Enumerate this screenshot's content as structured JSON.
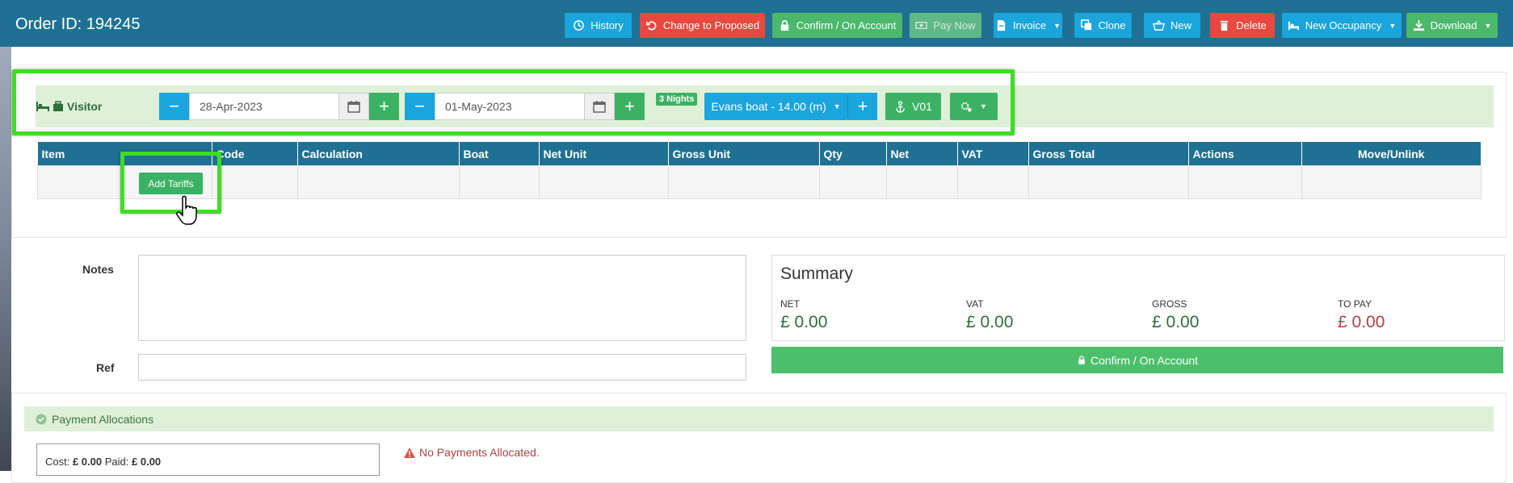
{
  "header": {
    "title": "Order ID: 194245",
    "buttons": {
      "history": "History",
      "change_to_proposed": "Change to Proposed",
      "confirm_on_account": "Confirm / On Account",
      "pay_now": "Pay Now",
      "invoice": "Invoice",
      "clone": "Clone",
      "new": "New",
      "delete": "Delete",
      "new_occupancy": "New Occupancy",
      "download": "Download"
    }
  },
  "visitor": {
    "label": "Visitor",
    "start_date": "28-Apr-2023",
    "end_date": "01-May-2023",
    "nights_badge": "3 Nights",
    "boat": "Evans boat - 14.00 (m)",
    "berth": "V01"
  },
  "tariff_table": {
    "columns": [
      "Item",
      "Code",
      "Calculation",
      "Boat",
      "Net Unit",
      "Gross Unit",
      "Qty",
      "Net",
      "VAT",
      "Gross Total",
      "Actions",
      "Move/Unlink"
    ],
    "add_tariffs_label": "Add Tariffs"
  },
  "notes": {
    "label": "Notes",
    "value": ""
  },
  "ref": {
    "label": "Ref",
    "value": ""
  },
  "summary": {
    "title": "Summary",
    "net_label": "NET",
    "net_value": "£ 0.00",
    "vat_label": "VAT",
    "vat_value": "£ 0.00",
    "gross_label": "GROSS",
    "gross_value": "£ 0.00",
    "to_pay_label": "TO PAY",
    "to_pay_value": "£ 0.00",
    "confirm_label": "Confirm / On Account"
  },
  "payment": {
    "title": "Payment Allocations",
    "cost_label": "Cost:",
    "cost_value": "£ 0.00",
    "paid_label": "Paid:",
    "paid_value": "£ 0.00",
    "no_payments": "No Payments Allocated."
  },
  "colors": {
    "header": "#1e7193",
    "accent_blue": "#1aa5dc",
    "green": "#3bb263",
    "red": "#e8483f",
    "highlight": "#3fdd25"
  }
}
